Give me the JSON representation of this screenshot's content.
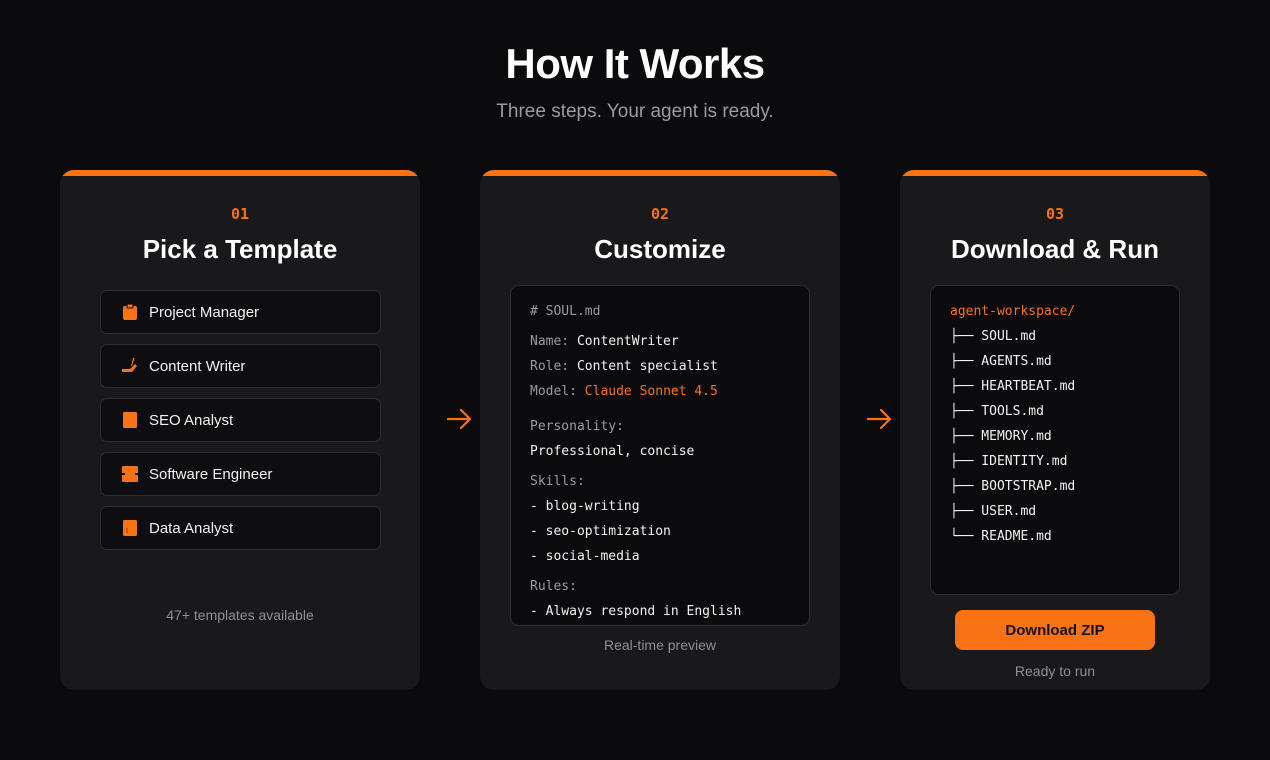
{
  "header": {
    "title": "How It Works",
    "subtitle": "Three steps. Your agent is ready."
  },
  "colors": {
    "accent": "#f97316",
    "background": "#0b0b0d",
    "card": "#19191c"
  },
  "steps": [
    {
      "number": "01",
      "title": "Pick a Template",
      "templates": [
        {
          "label": "Project Manager",
          "icon": "clipboard-icon"
        },
        {
          "label": "Content Writer",
          "icon": "writing-hand-icon"
        },
        {
          "label": "SEO Analyst",
          "icon": "bar-chart-icon"
        },
        {
          "label": "Software Engineer",
          "icon": "laptop-icon"
        },
        {
          "label": "Data Analyst",
          "icon": "chart-icon"
        }
      ],
      "footer": "47+ templates available"
    },
    {
      "number": "02",
      "title": "Customize",
      "code": {
        "header": "# SOUL.md",
        "name_key": "Name:",
        "name_value": "ContentWriter",
        "role_key": "Role:",
        "role_value": "Content specialist",
        "model_key": "Model:",
        "model_value": "Claude Sonnet 4.5",
        "personality_key": "Personality:",
        "personality_value": "Professional, concise",
        "skills_key": "Skills:",
        "skills": [
          "- blog-writing",
          "- seo-optimization",
          "- social-media"
        ],
        "rules_key": "Rules:",
        "rules": [
          "- Always respond in English"
        ]
      },
      "footer": "Real-time preview"
    },
    {
      "number": "03",
      "title": "Download & Run",
      "tree": {
        "root": "agent-workspace/",
        "files": [
          "├── SOUL.md",
          "├── AGENTS.md",
          "├── HEARTBEAT.md",
          "├── TOOLS.md",
          "├── MEMORY.md",
          "├── IDENTITY.md",
          "├── BOOTSTRAP.md",
          "├── USER.md",
          "└── README.md"
        ]
      },
      "button": "Download ZIP",
      "footer": "Ready to run"
    }
  ]
}
